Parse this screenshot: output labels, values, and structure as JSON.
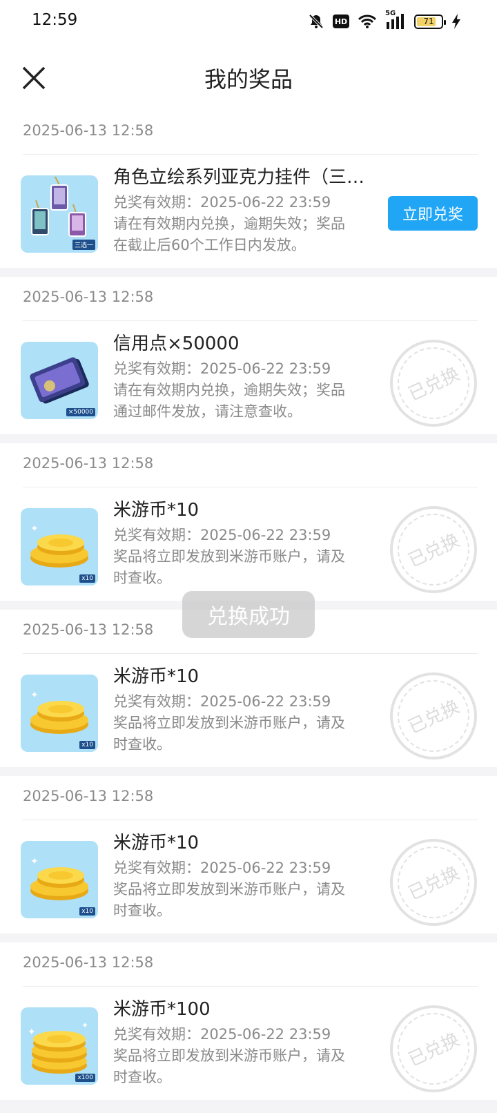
{
  "status_bar": {
    "time": "12:59",
    "hd": "HD",
    "network": "5G",
    "battery": "71"
  },
  "header": {
    "title": "我的奖品"
  },
  "prizes": [
    {
      "date": "2025-06-13 12:58",
      "name": "角色立绘系列亚克力挂件（三选一）",
      "validity": "兑奖有效期：2025-06-22 23:59",
      "desc_line1": "请在有效期内兑换，逾期失效；奖品",
      "desc_line2": "在截止后60个工作日内发放。",
      "tag": "三选一",
      "action": "立即兑奖",
      "status": "available"
    },
    {
      "date": "2025-06-13 12:58",
      "name": "信用点×50000",
      "validity": "兑奖有效期：2025-06-22 23:59",
      "desc_line1": "请在有效期内兑换，逾期失效；奖品",
      "desc_line2": "通过邮件发放，请注意查收。",
      "tag": "×50000",
      "stamp": "已兑换",
      "status": "redeemed"
    },
    {
      "date": "2025-06-13 12:58",
      "name": "米游币*10",
      "validity": "兑奖有效期：2025-06-22 23:59",
      "desc_line1": "奖品将立即发放到米游币账户，请及",
      "desc_line2": "时查收。",
      "tag": "x10",
      "stamp": "已兑换",
      "status": "redeemed"
    },
    {
      "date": "2025-06-13 12:58",
      "name": "米游币*10",
      "validity": "兑奖有效期：2025-06-22 23:59",
      "desc_line1": "奖品将立即发放到米游币账户，请及",
      "desc_line2": "时查收。",
      "tag": "x10",
      "stamp": "已兑换",
      "status": "redeemed"
    },
    {
      "date": "2025-06-13 12:58",
      "name": "米游币*10",
      "validity": "兑奖有效期：2025-06-22 23:59",
      "desc_line1": "奖品将立即发放到米游币账户，请及",
      "desc_line2": "时查收。",
      "tag": "x10",
      "stamp": "已兑换",
      "status": "redeemed"
    },
    {
      "date": "2025-06-13 12:58",
      "name": "米游币*100",
      "validity": "兑奖有效期：2025-06-22 23:59",
      "desc_line1": "奖品将立即发放到米游币账户，请及",
      "desc_line2": "时查收。",
      "tag": "x100",
      "stamp": "已兑换",
      "status": "redeemed"
    }
  ],
  "toast": "兑换成功",
  "colors": {
    "accent": "#21a6f5",
    "thumb_bg": "#aee0f7"
  }
}
